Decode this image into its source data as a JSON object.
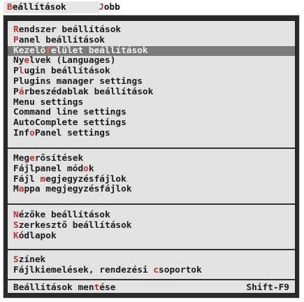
{
  "menubar": {
    "active": {
      "hotkey": "B",
      "rest": "eállítások"
    },
    "inactive": {
      "hotkey": "J",
      "rest": "obb"
    }
  },
  "groups": [
    {
      "items": [
        {
          "pre": "",
          "hk": "R",
          "post": "endszer beállítások"
        },
        {
          "pre": "",
          "hk": "P",
          "post": "anel beállítások"
        },
        {
          "pre": "Kezelő",
          "hk": "f",
          "post": "elület beállítások",
          "selected": true
        },
        {
          "pre": "Ny",
          "hk": "e",
          "post": "lvek (Languages)"
        },
        {
          "pre": "P",
          "hk": "l",
          "post": "ugin beállítások"
        },
        {
          "pre": "Plugins manager settings",
          "hk": "",
          "post": ""
        },
        {
          "pre": "P",
          "hk": "á",
          "post": "rbeszédablak beállítások"
        },
        {
          "pre": "Menu settings",
          "hk": "",
          "post": ""
        },
        {
          "pre": "Command line settings",
          "hk": "",
          "post": ""
        },
        {
          "pre": "AutoComplete settings",
          "hk": "",
          "post": ""
        },
        {
          "pre": "Inf",
          "hk": "o",
          "post": "Panel settings"
        }
      ]
    },
    {
      "items": [
        {
          "pre": "Meg",
          "hk": "e",
          "post": "rősítések"
        },
        {
          "pre": "Fájlpanel mód",
          "hk": "o",
          "post": "k"
        },
        {
          "pre": "Fájl ",
          "hk": "m",
          "post": "egjegyzésfájlok"
        },
        {
          "pre": "M",
          "hk": "a",
          "post": "ppa megjegyzésfájlok"
        }
      ]
    },
    {
      "items": [
        {
          "pre": "",
          "hk": "N",
          "post": "ézőke beállítások"
        },
        {
          "pre": "",
          "hk": "S",
          "post": "zerkesztő beállítások"
        },
        {
          "pre": "",
          "hk": "K",
          "post": "ódlapok"
        }
      ]
    },
    {
      "items": [
        {
          "pre": "",
          "hk": "S",
          "post": "zínek"
        },
        {
          "pre": "Fájlkiemelések, rendezési ",
          "hk": "c",
          "post": "soportok"
        }
      ]
    },
    {
      "items": [
        {
          "pre": "Beállítások men",
          "hk": "t",
          "post": "ése",
          "shortcut": "Shift-F9"
        }
      ]
    }
  ]
}
